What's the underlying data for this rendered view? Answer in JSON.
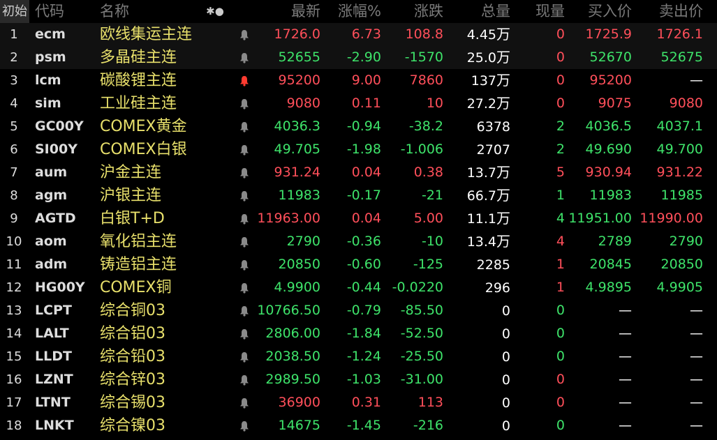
{
  "header": {
    "index": "初始",
    "code": "代码",
    "name": "名称",
    "symbol": "✱●",
    "last": "最新",
    "pct": "涨幅%",
    "chg": "涨跌",
    "vol": "总量",
    "cur": "现量",
    "bid": "买入价",
    "ask": "卖出价"
  },
  "rows": [
    {
      "idx": "1",
      "code": "ecm",
      "name": "欧线集运主连",
      "bell": "bell",
      "last": "1726.0",
      "pct": "6.73",
      "chg": "108.8",
      "vol": "4.45",
      "vol_unit": "万",
      "cur": "0",
      "bid": "1725.9",
      "ask": "1726.1",
      "dir": "up",
      "cur_dir": "up",
      "bid_dir": "up",
      "ask_dir": "up"
    },
    {
      "idx": "2",
      "code": "psm",
      "name": "多晶硅主连",
      "bell": "bell",
      "last": "52655",
      "pct": "-2.90",
      "chg": "-1570",
      "vol": "25.0",
      "vol_unit": "万",
      "cur": "0",
      "bid": "52670",
      "ask": "52675",
      "dir": "dn",
      "cur_dir": "up",
      "bid_dir": "dn",
      "ask_dir": "dn"
    },
    {
      "idx": "3",
      "code": "lcm",
      "name": "碳酸锂主连",
      "bell": "bell-red",
      "last": "95200",
      "pct": "9.00",
      "chg": "7860",
      "vol": "137",
      "vol_unit": "万",
      "cur": "0",
      "bid": "95200",
      "ask": "—",
      "dir": "up",
      "cur_dir": "up",
      "bid_dir": "up",
      "ask_dir": "flat"
    },
    {
      "idx": "4",
      "code": "sim",
      "name": "工业硅主连",
      "bell": "bell",
      "last": "9080",
      "pct": "0.11",
      "chg": "10",
      "vol": "27.2",
      "vol_unit": "万",
      "cur": "0",
      "bid": "9075",
      "ask": "9080",
      "dir": "up",
      "cur_dir": "up",
      "bid_dir": "up",
      "ask_dir": "up"
    },
    {
      "idx": "5",
      "code": "GC00Y",
      "name": "COMEX黄金",
      "bell": "bell",
      "last": "4036.3",
      "pct": "-0.94",
      "chg": "-38.2",
      "vol": "6378",
      "vol_unit": "",
      "cur": "2",
      "bid": "4036.5",
      "ask": "4037.1",
      "dir": "dn",
      "cur_dir": "dn",
      "bid_dir": "dn",
      "ask_dir": "dn"
    },
    {
      "idx": "6",
      "code": "SI00Y",
      "name": "COMEX白银",
      "bell": "bell",
      "last": "49.705",
      "pct": "-1.98",
      "chg": "-1.006",
      "vol": "2707",
      "vol_unit": "",
      "cur": "2",
      "bid": "49.690",
      "ask": "49.700",
      "dir": "dn",
      "cur_dir": "dn",
      "bid_dir": "dn",
      "ask_dir": "dn"
    },
    {
      "idx": "7",
      "code": "aum",
      "name": "沪金主连",
      "bell": "bell",
      "last": "931.24",
      "pct": "0.04",
      "chg": "0.38",
      "vol": "13.7",
      "vol_unit": "万",
      "cur": "5",
      "bid": "930.94",
      "ask": "931.22",
      "dir": "up",
      "cur_dir": "up",
      "bid_dir": "up",
      "ask_dir": "up"
    },
    {
      "idx": "8",
      "code": "agm",
      "name": "沪银主连",
      "bell": "bell",
      "last": "11983",
      "pct": "-0.17",
      "chg": "-21",
      "vol": "66.7",
      "vol_unit": "万",
      "cur": "1",
      "bid": "11983",
      "ask": "11985",
      "dir": "dn",
      "cur_dir": "dn",
      "bid_dir": "dn",
      "ask_dir": "dn"
    },
    {
      "idx": "9",
      "code": "AGTD",
      "name": "白银T+D",
      "bell": "bell",
      "last": "11963.00",
      "pct": "0.04",
      "chg": "5.00",
      "vol": "11.1",
      "vol_unit": "万",
      "cur": "4",
      "bid": "11951.00",
      "ask": "11990.00",
      "dir": "up",
      "cur_dir": "dn",
      "bid_dir": "dn",
      "ask_dir": "up"
    },
    {
      "idx": "10",
      "code": "aom",
      "name": "氧化铝主连",
      "bell": "bell",
      "last": "2790",
      "pct": "-0.36",
      "chg": "-10",
      "vol": "13.4",
      "vol_unit": "万",
      "cur": "4",
      "bid": "2789",
      "ask": "2790",
      "dir": "dn",
      "cur_dir": "up",
      "bid_dir": "dn",
      "ask_dir": "dn"
    },
    {
      "idx": "11",
      "code": "adm",
      "name": "铸造铝主连",
      "bell": "bell",
      "last": "20850",
      "pct": "-0.60",
      "chg": "-125",
      "vol": "2285",
      "vol_unit": "",
      "cur": "1",
      "bid": "20845",
      "ask": "20850",
      "dir": "dn",
      "cur_dir": "up",
      "bid_dir": "dn",
      "ask_dir": "dn"
    },
    {
      "idx": "12",
      "code": "HG00Y",
      "name": "COMEX铜",
      "bell": "bell",
      "last": "4.9900",
      "pct": "-0.44",
      "chg": "-0.0220",
      "vol": "296",
      "vol_unit": "",
      "cur": "1",
      "bid": "4.9895",
      "ask": "4.9905",
      "dir": "dn",
      "cur_dir": "up",
      "bid_dir": "dn",
      "ask_dir": "dn"
    },
    {
      "idx": "13",
      "code": "LCPT",
      "name": "综合铜03",
      "bell": "bell",
      "last": "10766.50",
      "pct": "-0.79",
      "chg": "-85.50",
      "vol": "0",
      "vol_unit": "",
      "cur": "0",
      "bid": "—",
      "ask": "—",
      "dir": "dn",
      "cur_dir": "dn",
      "bid_dir": "flat",
      "ask_dir": "flat"
    },
    {
      "idx": "14",
      "code": "LALT",
      "name": "综合铝03",
      "bell": "bell",
      "last": "2806.00",
      "pct": "-1.84",
      "chg": "-52.50",
      "vol": "0",
      "vol_unit": "",
      "cur": "0",
      "bid": "—",
      "ask": "—",
      "dir": "dn",
      "cur_dir": "dn",
      "bid_dir": "flat",
      "ask_dir": "flat"
    },
    {
      "idx": "15",
      "code": "LLDT",
      "name": "综合铅03",
      "bell": "bell",
      "last": "2038.50",
      "pct": "-1.24",
      "chg": "-25.50",
      "vol": "0",
      "vol_unit": "",
      "cur": "0",
      "bid": "—",
      "ask": "—",
      "dir": "dn",
      "cur_dir": "dn",
      "bid_dir": "flat",
      "ask_dir": "flat"
    },
    {
      "idx": "16",
      "code": "LZNT",
      "name": "综合锌03",
      "bell": "bell",
      "last": "2989.50",
      "pct": "-1.03",
      "chg": "-31.00",
      "vol": "0",
      "vol_unit": "",
      "cur": "0",
      "bid": "—",
      "ask": "—",
      "dir": "dn",
      "cur_dir": "up",
      "bid_dir": "flat",
      "ask_dir": "flat"
    },
    {
      "idx": "17",
      "code": "LTNT",
      "name": "综合锡03",
      "bell": "bell",
      "last": "36900",
      "pct": "0.31",
      "chg": "113",
      "vol": "0",
      "vol_unit": "",
      "cur": "0",
      "bid": "—",
      "ask": "—",
      "dir": "up",
      "cur_dir": "up",
      "bid_dir": "flat",
      "ask_dir": "flat"
    },
    {
      "idx": "18",
      "code": "LNKT",
      "name": "综合镍03",
      "bell": "bell",
      "last": "14675",
      "pct": "-1.45",
      "chg": "-216",
      "vol": "0",
      "vol_unit": "",
      "cur": "0",
      "bid": "—",
      "ask": "—",
      "dir": "dn",
      "cur_dir": "dn",
      "bid_dir": "flat",
      "ask_dir": "flat"
    }
  ]
}
